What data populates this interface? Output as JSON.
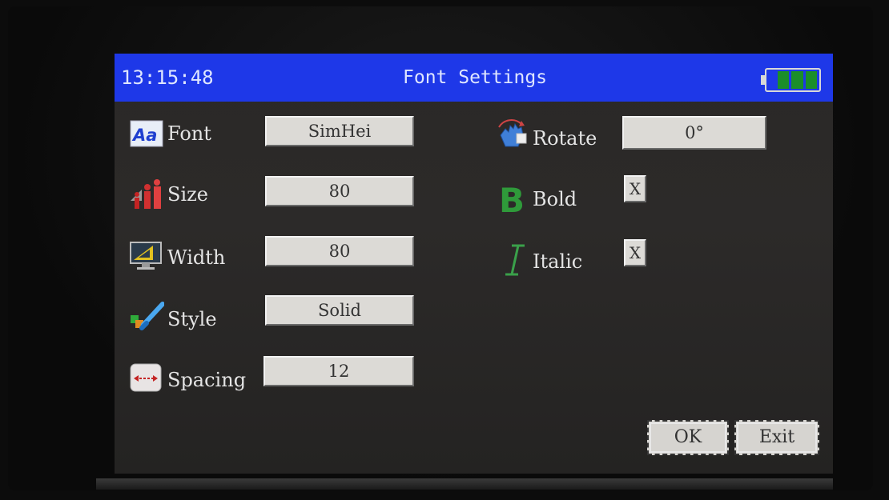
{
  "header": {
    "time": "13:15:48",
    "title": "Font Settings",
    "battery_icon": "battery-full-icon"
  },
  "left_settings": [
    {
      "label": "Font",
      "value": "SimHei",
      "icon": "font-aa-icon"
    },
    {
      "label": "Size",
      "value": "80",
      "icon": "size-figures-icon"
    },
    {
      "label": "Width",
      "value": "80",
      "icon": "width-monitor-icon"
    },
    {
      "label": "Style",
      "value": "Solid",
      "icon": "style-brush-icon"
    },
    {
      "label": "Spacing",
      "value": "12",
      "icon": "spacing-arrows-icon"
    }
  ],
  "right_settings": {
    "rotate": {
      "label": "Rotate",
      "value": "0°",
      "icon": "rotate-hand-icon"
    },
    "bold": {
      "label": "Bold",
      "checked": "X",
      "icon": "bold-b-icon"
    },
    "italic": {
      "label": "Italic",
      "checked": "X",
      "icon": "italic-i-icon"
    }
  },
  "actions": {
    "ok": "OK",
    "exit": "Exit"
  },
  "colors": {
    "titlebar": "#1e38e8",
    "screen_bg": "#2a2827",
    "field_bg": "#dcdad6",
    "battery_cell": "#1b8e2a",
    "bold_icon": "#2f9a3a",
    "italic_icon": "#3aa04a"
  }
}
